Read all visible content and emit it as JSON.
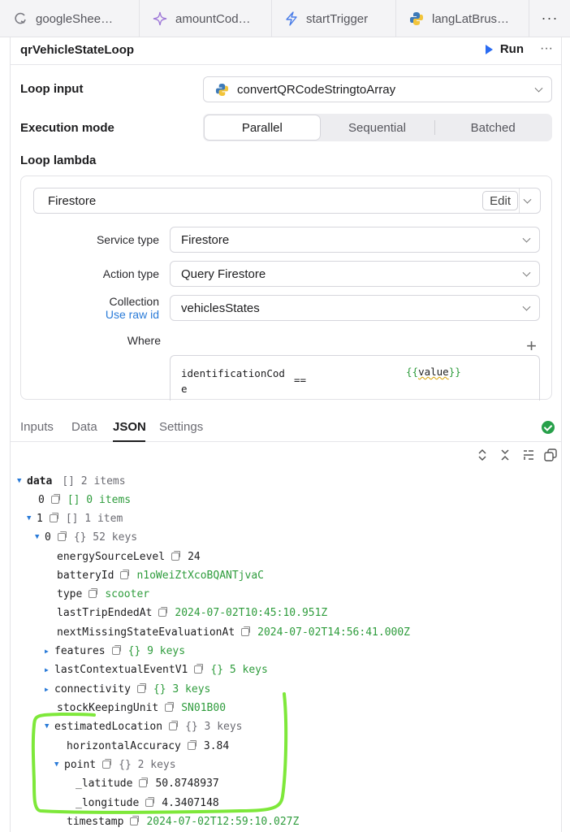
{
  "tabs": [
    {
      "label": "googleShee…",
      "icon": "refresh-icon"
    },
    {
      "label": "amountCod…",
      "icon": "sparkle-icon"
    },
    {
      "label": "startTrigger",
      "icon": "lightning-icon"
    },
    {
      "label": "langLatBrus…",
      "icon": "python-icon"
    }
  ],
  "tabbar_more": "···",
  "header": {
    "title": "qrVehicleStateLoop",
    "run_label": "Run",
    "more": "···"
  },
  "loop_input": {
    "label": "Loop input",
    "value": "convertQRCodeStringtoArray"
  },
  "execution_mode": {
    "label": "Execution mode",
    "options": [
      "Parallel",
      "Sequential",
      "Batched"
    ],
    "selected": "Parallel"
  },
  "loop_lambda": {
    "label": "Loop lambda",
    "resource": "Firestore",
    "edit_label": "Edit",
    "service_type": {
      "label": "Service type",
      "value": "Firestore"
    },
    "action_type": {
      "label": "Action type",
      "value": "Query Firestore"
    },
    "collection": {
      "label": "Collection",
      "link": "Use raw id",
      "value": "vehiclesStates"
    },
    "where": {
      "label": "Where",
      "field": "identificationCode",
      "operator": "==",
      "value_prefix": "{{",
      "value_var": "value",
      "value_suffix": "}}"
    }
  },
  "subtabs": [
    "Inputs",
    "Data",
    "JSON",
    "Settings"
  ],
  "active_subtab": "JSON",
  "json_tree": {
    "root": {
      "key": "data",
      "meta": "[]  2 items"
    },
    "item0": {
      "key": "0",
      "meta": "[]  0 items"
    },
    "item1": {
      "key": "1",
      "meta": "[]  1 item"
    },
    "obj0": {
      "key": "0",
      "meta": "{}  52 keys"
    },
    "energySourceLevel": {
      "key": "energySourceLevel",
      "value": "24"
    },
    "batteryId": {
      "key": "batteryId",
      "value": "n1oWeiZtXcoBQANTjvaC"
    },
    "type": {
      "key": "type",
      "value": "scooter"
    },
    "lastTripEndedAt": {
      "key": "lastTripEndedAt",
      "value": "2024-07-02T10:45:10.951Z"
    },
    "nextMissingStateEvaluationAt": {
      "key": "nextMissingStateEvaluationAt",
      "value": "2024-07-02T14:56:41.000Z"
    },
    "features": {
      "key": "features",
      "meta": "{}  9 keys"
    },
    "lastContextualEventV1": {
      "key": "lastContextualEventV1",
      "meta": "{}  5 keys"
    },
    "connectivity": {
      "key": "connectivity",
      "meta": "{}  3 keys"
    },
    "stockKeepingUnit": {
      "key": "stockKeepingUnit",
      "value": "SN01B00"
    },
    "estimatedLocation": {
      "key": "estimatedLocation",
      "meta": "{}  3 keys"
    },
    "horizontalAccuracy": {
      "key": "horizontalAccuracy",
      "value": "3.84"
    },
    "point": {
      "key": "point",
      "meta": "{}  2 keys"
    },
    "latitude": {
      "key": "_latitude",
      "value": "50.8748937"
    },
    "longitude": {
      "key": "_longitude",
      "value": "4.3407148"
    },
    "timestamp": {
      "key": "timestamp",
      "value": "2024-07-02T12:59:10.027Z"
    }
  },
  "colors": {
    "accent": "#2a6bf2",
    "string_value": "#2e9c3c",
    "highlight_stroke": "#7ee83a",
    "success": "#27a04a"
  }
}
